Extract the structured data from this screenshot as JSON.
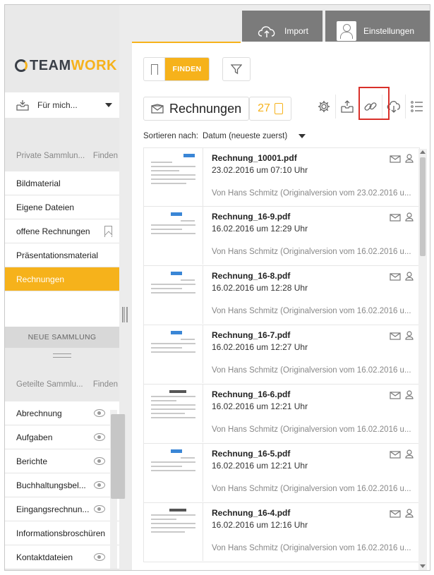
{
  "brand": {
    "part1": "TEAM",
    "part2": "WORK",
    "accent": "#f6b21b",
    "dark": "#3a3f47"
  },
  "scope": {
    "label": "Für mich...",
    "icon": "inbox-icon"
  },
  "private_section": {
    "title": "Private Sammlun...",
    "action": "Finden"
  },
  "private_items": [
    {
      "label": "Bildmaterial"
    },
    {
      "label": "Eigene Dateien"
    },
    {
      "label": "offene Rechnungen",
      "icon": "bookmark-icon"
    },
    {
      "label": "Präsentationsmaterial"
    },
    {
      "label": "Rechnungen",
      "active": true
    }
  ],
  "new_collection": {
    "label": "NEUE SAMMLUNG"
  },
  "shared_section": {
    "title": "Geteilte Sammlu...",
    "action": "Finden"
  },
  "shared_items": [
    {
      "label": "Abrechnung",
      "icon": "eye-icon"
    },
    {
      "label": "Aufgaben",
      "icon": "eye-icon"
    },
    {
      "label": "Berichte",
      "icon": "eye-icon"
    },
    {
      "label": "Buchhaltungsbel...",
      "icon": "eye-icon"
    },
    {
      "label": "Eingangsrechnun...",
      "icon": "eye-icon"
    },
    {
      "label": "Informationsbroschüren"
    },
    {
      "label": "Kontaktdateien",
      "icon": "eye-icon"
    }
  ],
  "search": {
    "find_label": "FINDEN"
  },
  "tabs": {
    "import": "Import",
    "settings": "Einstellungen"
  },
  "collection": {
    "title": "Rechnungen",
    "count": "27"
  },
  "toolbar_icons": [
    "gear-icon",
    "share-upload-icon",
    "link-icon",
    "cloud-download-icon",
    "list-view-icon"
  ],
  "sort": {
    "label": "Sortieren nach:",
    "value": "Datum (neueste zuerst)"
  },
  "documents": [
    {
      "name": "Rechnung_10001.pdf",
      "date": "23.02.2016 um 07:10 Uhr",
      "by": "Von Hans Schmitz (Originalversion vom 23.02.2016 u..."
    },
    {
      "name": "Rechnung_16-9.pdf",
      "date": "16.02.2016 um 12:29 Uhr",
      "by": "Von Hans Schmitz (Originalversion vom 16.02.2016 u..."
    },
    {
      "name": "Rechnung_16-8.pdf",
      "date": "16.02.2016 um 12:28 Uhr",
      "by": "Von Hans Schmitz (Originalversion vom 16.02.2016 u..."
    },
    {
      "name": "Rechnung_16-7.pdf",
      "date": "16.02.2016 um 12:27 Uhr",
      "by": "Von Hans Schmitz (Originalversion vom 16.02.2016 u..."
    },
    {
      "name": "Rechnung_16-6.pdf",
      "date": "16.02.2016 um 12:21 Uhr",
      "by": "Von Hans Schmitz (Originalversion vom 16.02.2016 u..."
    },
    {
      "name": "Rechnung_16-5.pdf",
      "date": "16.02.2016 um 12:21 Uhr",
      "by": "Von Hans Schmitz (Originalversion vom 16.02.2016 u..."
    },
    {
      "name": "Rechnung_16-4.pdf",
      "date": "16.02.2016 um 12:16 Uhr",
      "by": "Von Hans Schmitz (Originalversion vom 16.02.2016 u..."
    }
  ]
}
